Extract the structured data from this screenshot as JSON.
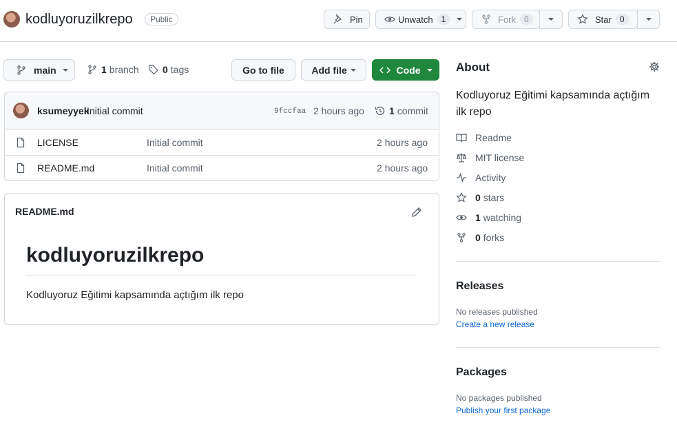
{
  "repo": {
    "name": "kodluyoruzilkrepo",
    "visibility": "Public"
  },
  "header_actions": {
    "pin_label": "Pin",
    "unwatch_label": "Unwatch",
    "unwatch_count": "1",
    "fork_label": "Fork",
    "fork_count": "0",
    "star_label": "Star",
    "star_count": "0"
  },
  "toolbar": {
    "branch_name": "main",
    "branch_count": "1",
    "branch_label": "branch",
    "tag_count": "0",
    "tag_label": "tags",
    "go_to_file": "Go to file",
    "add_file": "Add file",
    "code": "Code"
  },
  "commit": {
    "author": "ksumeyyek",
    "message": "Initial commit",
    "hash": "9fccfaa",
    "time": "2 hours ago",
    "count": "1",
    "count_label": "commit"
  },
  "files": [
    {
      "name": "LICENSE",
      "message": "Initial commit",
      "time": "2 hours ago"
    },
    {
      "name": "README.md",
      "message": "Initial commit",
      "time": "2 hours ago"
    }
  ],
  "readme": {
    "filename": "README.md",
    "heading": "kodluyoruzilkrepo",
    "body": "Kodluyoruz Eğitimi kapsamında açtığım ilk repo"
  },
  "about": {
    "title": "About",
    "description": "Kodluyoruz Eğitimi kapsamında açtığım ilk repo",
    "readme": "Readme",
    "license": "MIT license",
    "activity": "Activity",
    "stars_count": "0",
    "stars_label": "stars",
    "watching_count": "1",
    "watching_label": "watching",
    "forks_count": "0",
    "forks_label": "forks"
  },
  "releases": {
    "title": "Releases",
    "empty": "No releases published",
    "create_link": "Create a new release"
  },
  "packages": {
    "title": "Packages",
    "empty": "No packages published",
    "publish_link": "Publish your first package"
  },
  "colors": {
    "green": "#1f883d",
    "link": "#0969da",
    "border": "#d0d7de"
  }
}
